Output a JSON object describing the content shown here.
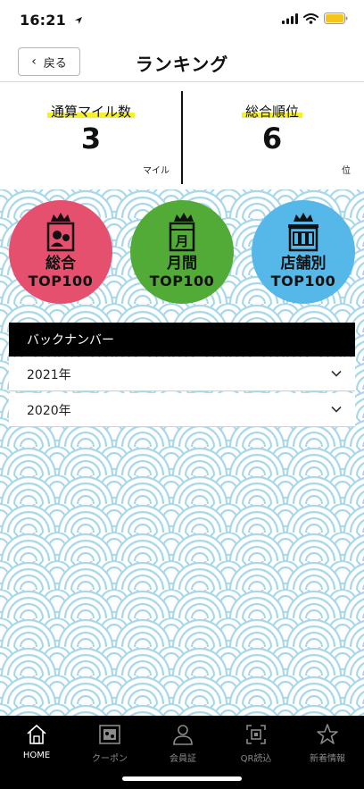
{
  "status_bar": {
    "time": "16:21"
  },
  "nav": {
    "back_label": "戻る",
    "title": "ランキング"
  },
  "stats": {
    "miles": {
      "label": "通算マイル数",
      "value": "3",
      "unit": "マイル"
    },
    "rank": {
      "label": "総合順位",
      "value": "6",
      "unit": "位"
    }
  },
  "ranking_buttons": [
    {
      "line1": "総合",
      "line2": "TOP100",
      "icon": "crown-person-icon",
      "color": "#e6506f"
    },
    {
      "line1": "月間",
      "line2": "TOP100",
      "icon": "crown-calendar-icon",
      "color": "#53ab37"
    },
    {
      "line1": "店舗別",
      "line2": "TOP100",
      "icon": "crown-store-icon",
      "color": "#55b8e8"
    }
  ],
  "back_numbers": {
    "header": "バックナンバー",
    "years": [
      "2021年",
      "2020年"
    ]
  },
  "tab_bar": {
    "items": [
      {
        "label": "HOME",
        "icon": "home-icon",
        "active": true
      },
      {
        "label": "クーポン",
        "icon": "coupon-icon",
        "active": false
      },
      {
        "label": "会員証",
        "icon": "member-card-icon",
        "active": false
      },
      {
        "label": "QR読込",
        "icon": "qr-scan-icon",
        "active": false
      },
      {
        "label": "新着情報",
        "icon": "star-icon",
        "active": false
      }
    ]
  },
  "colors": {
    "accent_highlight": "#f6f02a",
    "pattern_stroke": "#a9d8ec",
    "header_bg": "#000000"
  }
}
